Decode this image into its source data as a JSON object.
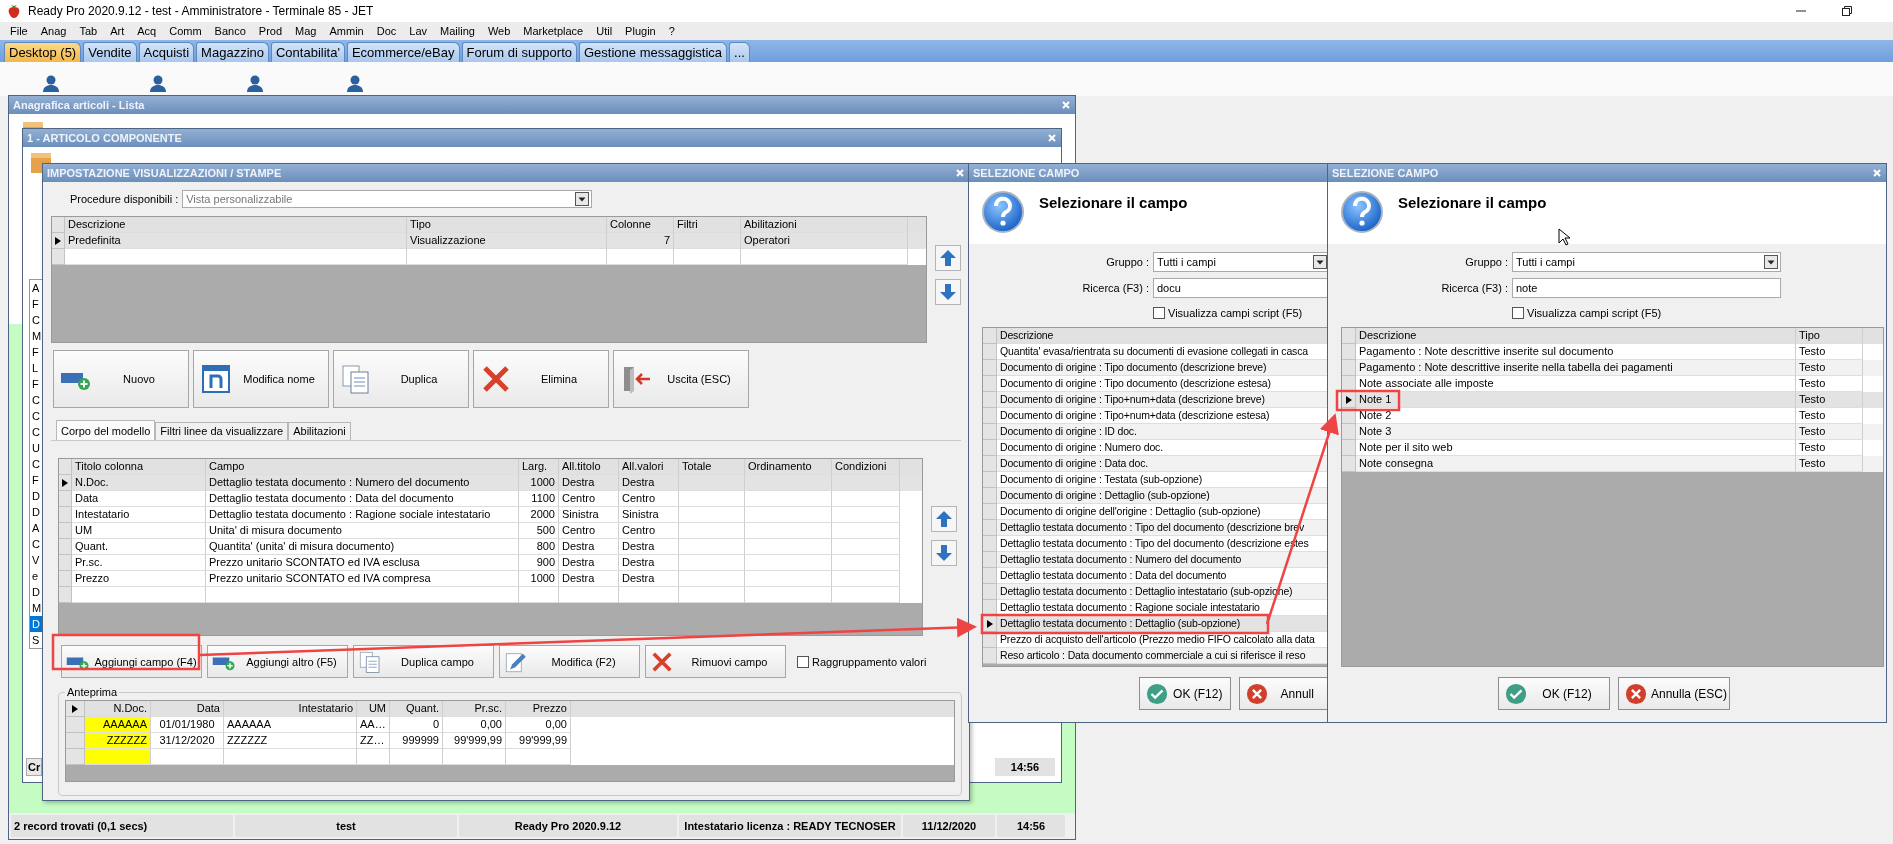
{
  "app": {
    "title": "Ready Pro 2020.9.12 - test - Amministratore - Terminale 85 - JET"
  },
  "menu": [
    "File",
    "Anag",
    "Tab",
    "Art",
    "Acq",
    "Comm",
    "Banco",
    "Prod",
    "Mag",
    "Ammin",
    "Doc",
    "Lav",
    "Mailing",
    "Web",
    "Marketplace",
    "Util",
    "Plugin",
    "?"
  ],
  "tabs": [
    {
      "label": "Desktop (5)",
      "selected": true
    },
    {
      "label": "Vendite",
      "selected": false
    },
    {
      "label": "Acquisti",
      "selected": false
    },
    {
      "label": "Magazzino",
      "selected": false
    },
    {
      "label": "Contabilita'",
      "selected": false
    },
    {
      "label": "Ecommerce/eBay",
      "selected": false
    },
    {
      "label": "Forum di supporto",
      "selected": false
    },
    {
      "label": "Gestione messaggistica",
      "selected": false
    },
    {
      "label": "...",
      "selected": false
    }
  ],
  "list_window": {
    "title": "Anagrafica articoli  - Lista",
    "status_bar": [
      "2 record trovati (0,1 secs)",
      "test",
      "Ready Pro 2020.9.12",
      "Intestatario licenza : READY TECNOSER",
      "11/12/2020",
      "14:56"
    ]
  },
  "detail_window": {
    "title": "1 - ARTICOLO COMPONENTE",
    "footer_left": "Cr",
    "footer_time": "14:56",
    "row_initials": [
      {
        "text": "A",
        "selected": false
      },
      {
        "text": "F",
        "selected": false
      },
      {
        "text": "C",
        "selected": false
      },
      {
        "text": "M",
        "selected": false
      },
      {
        "text": "F",
        "selected": false
      },
      {
        "text": "L",
        "selected": false
      },
      {
        "text": "F",
        "selected": false
      },
      {
        "text": "C",
        "selected": false
      },
      {
        "text": "C",
        "selected": false
      },
      {
        "text": "C",
        "selected": false
      },
      {
        "text": "U",
        "selected": false
      },
      {
        "text": "C",
        "selected": false
      },
      {
        "text": "F",
        "selected": false
      },
      {
        "text": "D",
        "selected": false
      },
      {
        "text": "D",
        "selected": false
      },
      {
        "text": "A",
        "selected": false
      },
      {
        "text": "C",
        "selected": false
      },
      {
        "text": "V",
        "selected": false
      },
      {
        "text": "e",
        "selected": false
      },
      {
        "text": "D",
        "selected": false
      },
      {
        "text": "M",
        "selected": false
      },
      {
        "text": "D",
        "selected": true
      },
      {
        "text": "S",
        "selected": false
      }
    ]
  },
  "settings_dialog": {
    "title": "IMPOSTAZIONE VISUALIZZAZIONI / STAMPE",
    "procedure_label": "Procedure disponibili :",
    "procedure_value": "Vista personalizzabile",
    "models_table": {
      "columns": [
        "Descrizione",
        "Tipo",
        "Colonne",
        "Filtri",
        "Abilitazioni"
      ],
      "rows": [
        {
          "cells": [
            "Predefinita",
            "Visualizzazione",
            "7",
            null,
            "Operatori"
          ],
          "selected": true
        }
      ]
    },
    "buttons": [
      {
        "kind": "new",
        "label": "Nuovo"
      },
      {
        "kind": "rename",
        "label": "Modifica nome"
      },
      {
        "kind": "duplicate",
        "label": "Duplica"
      },
      {
        "kind": "delete",
        "label": "Elimina"
      },
      {
        "kind": "exit",
        "label": "Uscita (ESC)"
      }
    ],
    "tabs": [
      {
        "label": "Corpo del modello",
        "selected": true
      },
      {
        "label": "Filtri linee da visualizzare",
        "selected": false
      },
      {
        "label": "Abilitazioni",
        "selected": false
      }
    ],
    "fields_table": {
      "columns": [
        "Titolo colonna",
        "Campo",
        "Larg.",
        "All.titolo",
        "All.valori",
        "Totale",
        "Ordinamento",
        "Condizioni"
      ],
      "rows": [
        {
          "cells": [
            "N.Doc.",
            "Dettaglio testata documento : Numero del documento",
            "1000",
            "Destra",
            "Destra"
          ],
          "selected": true
        },
        {
          "cells": [
            "Data",
            "Dettaglio testata documento : Data del documento",
            "1100",
            "Centro",
            "Centro"
          ],
          "selected": false
        },
        {
          "cells": [
            "Intestatario",
            "Dettaglio testata documento : Ragione sociale intestatario",
            "2000",
            "Sinistra",
            "Sinistra"
          ],
          "selected": false
        },
        {
          "cells": [
            "UM",
            "Unita' di misura documento",
            "500",
            "Centro",
            "Centro"
          ],
          "selected": false
        },
        {
          "cells": [
            "Quant.",
            "Quantita' (unita' di misura documento)",
            "800",
            "Destra",
            "Destra"
          ],
          "selected": false
        },
        {
          "cells": [
            "Pr.sc.",
            "Prezzo unitario SCONTATO ed IVA esclusa",
            "900",
            "Destra",
            "Destra"
          ],
          "selected": false
        },
        {
          "cells": [
            "Prezzo",
            "Prezzo unitario SCONTATO ed IVA compresa",
            "1000",
            "Destra",
            "Destra"
          ],
          "selected": false
        }
      ]
    },
    "field_buttons": [
      {
        "kind": "add",
        "label": "Aggiungi campo (F4)"
      },
      {
        "kind": "add",
        "label": "Aggiungi altro (F5)"
      },
      {
        "kind": "duplicate",
        "label": "Duplica campo"
      },
      {
        "kind": "edit",
        "label": "Modifica (F2)"
      },
      {
        "kind": "remove",
        "label": "Rimuovi campo"
      }
    ],
    "grouping_checkbox": {
      "label": "Raggruppamento valori",
      "checked": false
    },
    "preview": {
      "title": "Anteprima",
      "columns": [
        {
          "label": "N.Doc.",
          "highlighted": true
        },
        {
          "label": "Data",
          "highlighted": false
        },
        {
          "label": "Intestatario",
          "highlighted": false
        },
        {
          "label": "UM",
          "highlighted": false
        },
        {
          "label": "Quant.",
          "highlighted": false
        },
        {
          "label": "Pr.sc.",
          "highlighted": false
        },
        {
          "label": "Prezzo",
          "highlighted": false
        }
      ],
      "rows": [
        [
          "AAAAAA",
          "01/01/1980",
          "AAAAAA",
          "AA…",
          "0",
          "0,00",
          "0,00"
        ],
        [
          "ZZZZZZ",
          "31/12/2020",
          "ZZZZZZ",
          "ZZ…",
          "999999",
          "99'999,99",
          "99'999,99"
        ]
      ]
    }
  },
  "field_pickers": [
    {
      "title": "SELEZIONE CAMPO",
      "closable": false,
      "heading": "Selezionare il campo",
      "group_label": "Gruppo :",
      "group_value": "Tutti i campi",
      "search_label": "Ricerca (F3) :",
      "search_value": "docu",
      "script_checkbox": {
        "label": "Visualizza campi script (F5)",
        "checked": false
      },
      "columns": [
        "Descrizione"
      ],
      "rows": [
        {
          "cells": [
            "Quantita' evasa/rientrata su documenti di evasione collegati in casca"
          ],
          "selected": false
        },
        {
          "cells": [
            "Documento di origine : Tipo documento (descrizione breve)"
          ],
          "selected": false
        },
        {
          "cells": [
            "Documento di origine : Tipo documento (descrizione estesa)"
          ],
          "selected": false
        },
        {
          "cells": [
            "Documento di origine : Tipo+num+data (descrizione breve)"
          ],
          "selected": false
        },
        {
          "cells": [
            "Documento di origine : Tipo+num+data (descrizione estesa)"
          ],
          "selected": false
        },
        {
          "cells": [
            "Documento di origine : ID doc."
          ],
          "selected": false
        },
        {
          "cells": [
            "Documento di origine : Numero doc."
          ],
          "selected": false
        },
        {
          "cells": [
            "Documento di origine : Data doc."
          ],
          "selected": false
        },
        {
          "cells": [
            "Documento di origine : Testata (sub-opzione)"
          ],
          "selected": false
        },
        {
          "cells": [
            "Documento di origine : Dettaglio (sub-opzione)"
          ],
          "selected": false
        },
        {
          "cells": [
            "Documento di origine dell'origine : Dettaglio (sub-opzione)"
          ],
          "selected": false
        },
        {
          "cells": [
            "Dettaglio testata documento : Tipo del documento (descrizione brev"
          ],
          "selected": false
        },
        {
          "cells": [
            "Dettaglio testata documento : Tipo del documento (descrizione estes"
          ],
          "selected": false
        },
        {
          "cells": [
            "Dettaglio testata documento : Numero del documento"
          ],
          "selected": false
        },
        {
          "cells": [
            "Dettaglio testata documento : Data del documento"
          ],
          "selected": false
        },
        {
          "cells": [
            "Dettaglio testata documento : Dettaglio intestatario (sub-opzione)"
          ],
          "selected": false
        },
        {
          "cells": [
            "Dettaglio testata documento : Ragione sociale intestatario"
          ],
          "selected": false
        },
        {
          "cells": [
            "Dettaglio testata documento : Dettaglio (sub-opzione)"
          ],
          "selected": true
        },
        {
          "cells": [
            "Prezzo di acquisto dell'articolo (Prezzo medio FIFO calcolato alla data"
          ],
          "selected": false
        },
        {
          "cells": [
            "Reso articolo : Data documento commerciale a cui si riferisce il reso"
          ],
          "selected": false
        }
      ],
      "buttons": [
        {
          "kind": "ok",
          "label": "OK (F12)"
        },
        {
          "kind": "cancel",
          "label": "Annull"
        }
      ]
    },
    {
      "title": "SELEZIONE CAMPO",
      "closable": true,
      "heading": "Selezionare il campo",
      "group_label": "Gruppo :",
      "group_value": "Tutti i campi",
      "search_label": "Ricerca (F3) :",
      "search_value": "note",
      "script_checkbox": {
        "label": "Visualizza campi script (F5)",
        "checked": false
      },
      "columns": [
        "Descrizione",
        "Tipo"
      ],
      "rows": [
        {
          "cells": [
            "Pagamento : Note descrittive inserite sul documento",
            "Testo"
          ],
          "selected": false
        },
        {
          "cells": [
            "Pagamento : Note descrittive inserite nella tabella dei pagamenti",
            "Testo"
          ],
          "selected": false
        },
        {
          "cells": [
            "Note associate alle imposte",
            "Testo"
          ],
          "selected": false
        },
        {
          "cells": [
            "Note 1",
            "Testo"
          ],
          "selected": true
        },
        {
          "cells": [
            "Note 2",
            "Testo"
          ],
          "selected": false
        },
        {
          "cells": [
            "Note 3",
            "Testo"
          ],
          "selected": false
        },
        {
          "cells": [
            "Note per il sito web",
            "Testo"
          ],
          "selected": false
        },
        {
          "cells": [
            "Note consegna",
            "Testo"
          ],
          "selected": false
        }
      ],
      "buttons": [
        {
          "kind": "ok",
          "label": "OK (F12)"
        },
        {
          "kind": "cancel",
          "label": "Annulla (ESC)"
        }
      ]
    }
  ]
}
